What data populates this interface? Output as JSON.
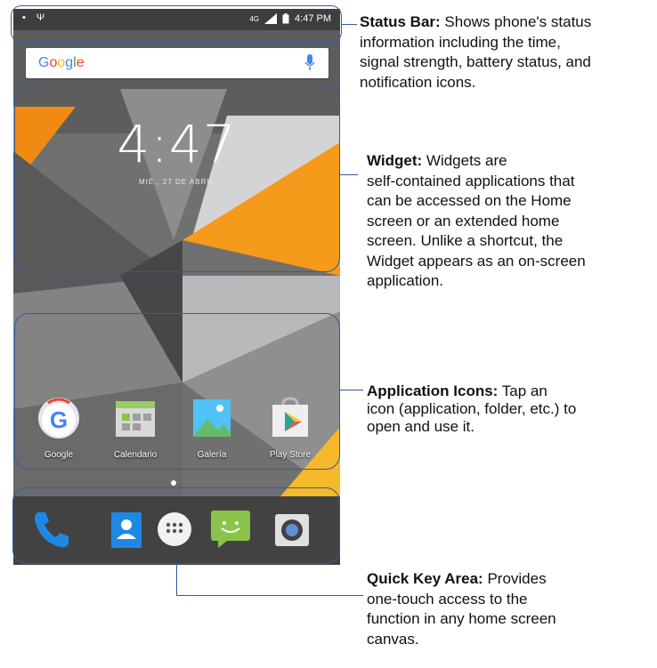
{
  "status_bar": {
    "time": "4:47 PM",
    "network": "4G"
  },
  "search": {
    "logo": "Google",
    "icon": "mic-icon"
  },
  "clock_widget": {
    "time": "4:47",
    "date": "MIÉ., 27 DE ABRIL"
  },
  "apps": [
    {
      "label": "Google",
      "icon": "google-app-icon"
    },
    {
      "label": "Calendario",
      "icon": "calendar-icon"
    },
    {
      "label": "Galería",
      "icon": "gallery-icon"
    },
    {
      "label": "Play Store",
      "icon": "play-store-icon"
    }
  ],
  "dock": [
    {
      "name": "phone",
      "icon": "phone-icon"
    },
    {
      "name": "contacts",
      "icon": "contacts-icon"
    },
    {
      "name": "app-drawer",
      "icon": "app-drawer-icon"
    },
    {
      "name": "messaging",
      "icon": "messaging-icon"
    },
    {
      "name": "camera",
      "icon": "camera-icon"
    }
  ],
  "annotations": {
    "status_bar": {
      "title": "Status Bar:",
      "lines": [
        " Shows phone's status",
        "information including the time,",
        "signal strength, battery status, and",
        "notification icons."
      ]
    },
    "widget": {
      "title": "Widget:",
      "lines": [
        " Widgets are",
        "self-contained applications that",
        "can be accessed on the Home",
        "screen or an extended home",
        "screen. Unlike a shortcut, the",
        "Widget appears as an on-screen",
        "application."
      ]
    },
    "app_icons": {
      "title": "Application Icons:",
      "lines": [
        " Tap an",
        "icon (application, folder, etc.) to",
        "open and use it."
      ]
    },
    "quick_key": {
      "title": "Quick Key Area:",
      "lines": [
        " Provides",
        "one-touch access to the",
        "function in any home screen",
        "canvas."
      ]
    }
  },
  "colors": {
    "accent": "#2f5da0",
    "wallpaper_orange": "#f08a12",
    "wallpaper_grey": "#6f6f6f"
  }
}
